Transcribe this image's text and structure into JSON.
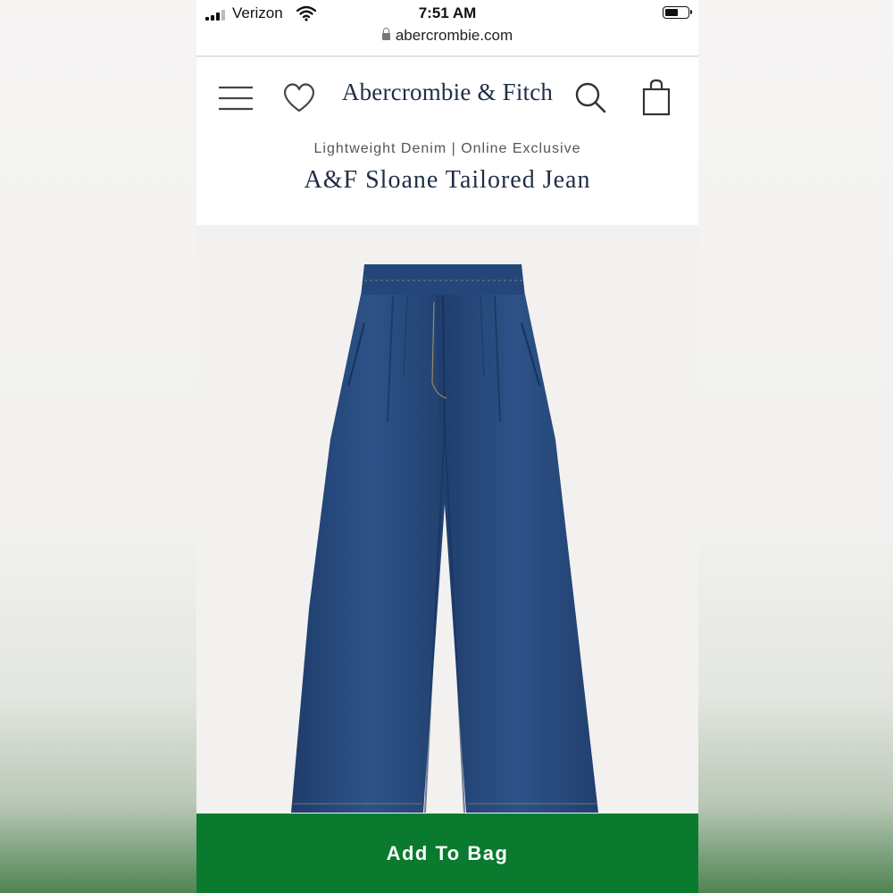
{
  "status_bar": {
    "carrier": "Verizon",
    "time": "7:51 AM",
    "icons": [
      "cellular-signal-icon",
      "wifi-icon",
      "battery-icon"
    ]
  },
  "browser": {
    "url": "abercrombie.com",
    "icon": "lock-icon"
  },
  "header": {
    "logo": "Abercrombie & Fitch",
    "icons": [
      "menu-icon",
      "heart-icon",
      "search-icon",
      "shopping-bag-icon"
    ]
  },
  "product": {
    "eyebrow": "Lightweight Denim | Online Exclusive",
    "title": "A&F Sloane Tailored Jean",
    "image_subject": "wide-leg dark wash denim jeans"
  },
  "cta": {
    "add_to_bag": "Add To Bag"
  },
  "colors": {
    "brand_navy": "#1f2e45",
    "cta_green": "#0a7a2e",
    "denim": "#274a7e",
    "image_background": "#f3f1ef"
  }
}
